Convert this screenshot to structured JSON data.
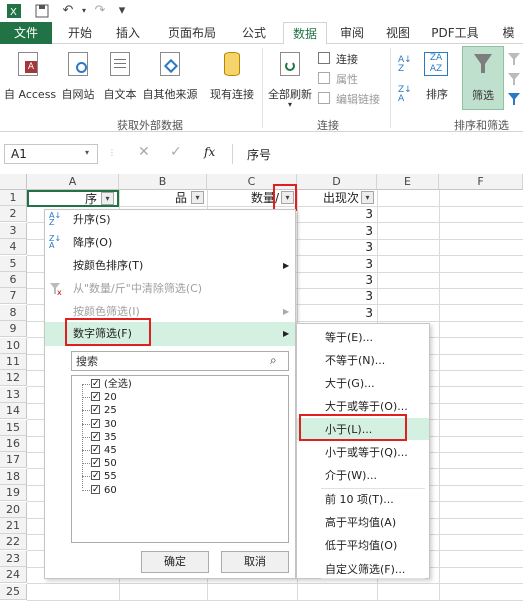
{
  "tabs": [
    "文件",
    "开始",
    "插入",
    "页面布局",
    "公式",
    "数据",
    "审阅",
    "视图",
    "PDF工具",
    "模"
  ],
  "ribbon": {
    "get_external": [
      "自 Access",
      "自网站",
      "自文本",
      "自其他来源",
      "现有连接"
    ],
    "refresh_all": "全部刷新",
    "connections": [
      "连接",
      "属性",
      "编辑链接"
    ],
    "sort": "排序",
    "filter": "筛选",
    "group_get_external": "获取外部数据",
    "group_connections": "连接",
    "group_sort_filter": "排序和筛选"
  },
  "formula_bar": {
    "name_box": "A1",
    "fx": "fx",
    "content": "序号"
  },
  "columns": [
    "A",
    "B",
    "C",
    "D",
    "E",
    "F"
  ],
  "rows": [
    "1",
    "2",
    "3",
    "4",
    "5",
    "6",
    "7",
    "8",
    "9",
    "10",
    "11",
    "12",
    "13",
    "14",
    "15",
    "16",
    "17",
    "18",
    "19",
    "20",
    "21",
    "22",
    "23",
    "24",
    "25"
  ],
  "headers": {
    "a1": "序",
    "b1": "品",
    "c1": "数量/",
    "d1": "出现次"
  },
  "d_values": [
    "3",
    "3",
    "3",
    "3",
    "3",
    "3",
    "3",
    "3",
    "3",
    "3"
  ],
  "filter_menu": {
    "sort_asc": "升序(S)",
    "sort_desc": "降序(O)",
    "sort_by_color": "按颜色排序(T)",
    "clear_filter": "从\"数量/斤\"中清除筛选(C)",
    "filter_by_color": "按颜色筛选(I)",
    "number_filter": "数字筛选(F)",
    "search_placeholder": "搜索",
    "items": [
      "(全选)",
      "20",
      "25",
      "30",
      "35",
      "45",
      "50",
      "55",
      "60"
    ],
    "ok": "确定",
    "cancel": "取消"
  },
  "submenu": [
    "等于(E)...",
    "不等于(N)...",
    "大于(G)...",
    "大于或等于(O)...",
    "小于(L)...",
    "小于或等于(Q)...",
    "介于(W)...",
    "前 10 项(T)...",
    "高于平均值(A)",
    "低于平均值(O)",
    "自定义筛选(F)..."
  ],
  "colors": {
    "excel_green": "#217346",
    "highlight": "#d3f0e0",
    "red_box": "#e02020"
  }
}
